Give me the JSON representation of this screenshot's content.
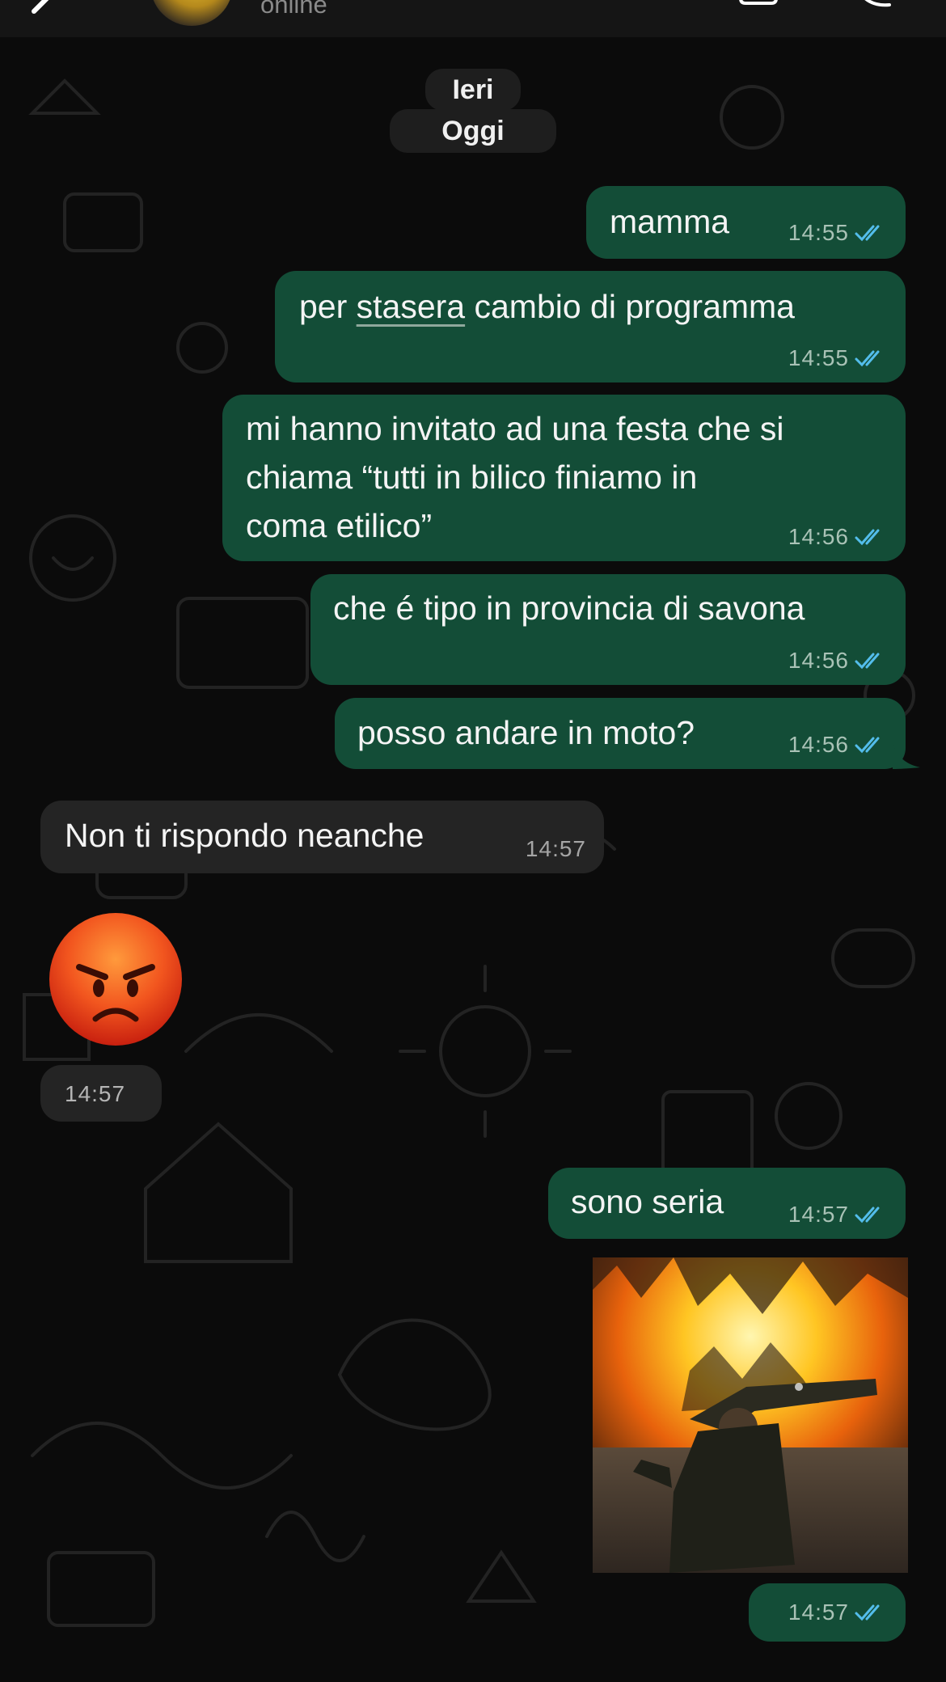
{
  "header": {
    "status": "online"
  },
  "date_labels": {
    "yesterday": "Ieri",
    "today": "Oggi"
  },
  "messages": [
    {
      "direction": "out",
      "text": "mamma",
      "time": "14:55",
      "read": true
    },
    {
      "direction": "out",
      "text_before": "per ",
      "text_underlined": "stasera",
      "text_after": " cambio di programma",
      "time": "14:55",
      "read": true
    },
    {
      "direction": "out",
      "text": "mi hanno invitato ad una festa che si\nchiama “tutti in bilico finiamo in\ncoma etilico”",
      "time": "14:56",
      "read": true
    },
    {
      "direction": "out",
      "text": "che é tipo in provincia di savona",
      "time": "14:56",
      "read": true
    },
    {
      "direction": "out",
      "text": "posso andare in moto?",
      "time": "14:56",
      "read": true
    },
    {
      "direction": "in",
      "text": "Non ti rispondo neanche",
      "time": "14:57"
    },
    {
      "direction": "in",
      "emoji": "angry-face",
      "time": "14:57"
    },
    {
      "direction": "out",
      "text": "sono seria",
      "time": "14:57",
      "read": true
    },
    {
      "direction": "out",
      "media": "gif-person-dabbing-in-front-of-fire",
      "time": "14:57",
      "read": true
    }
  ],
  "colors": {
    "background": "#0b0b0b",
    "outgoing_bubble": "#134d37",
    "incoming_bubble": "#242424",
    "read_ticks": "#53bdeb"
  }
}
